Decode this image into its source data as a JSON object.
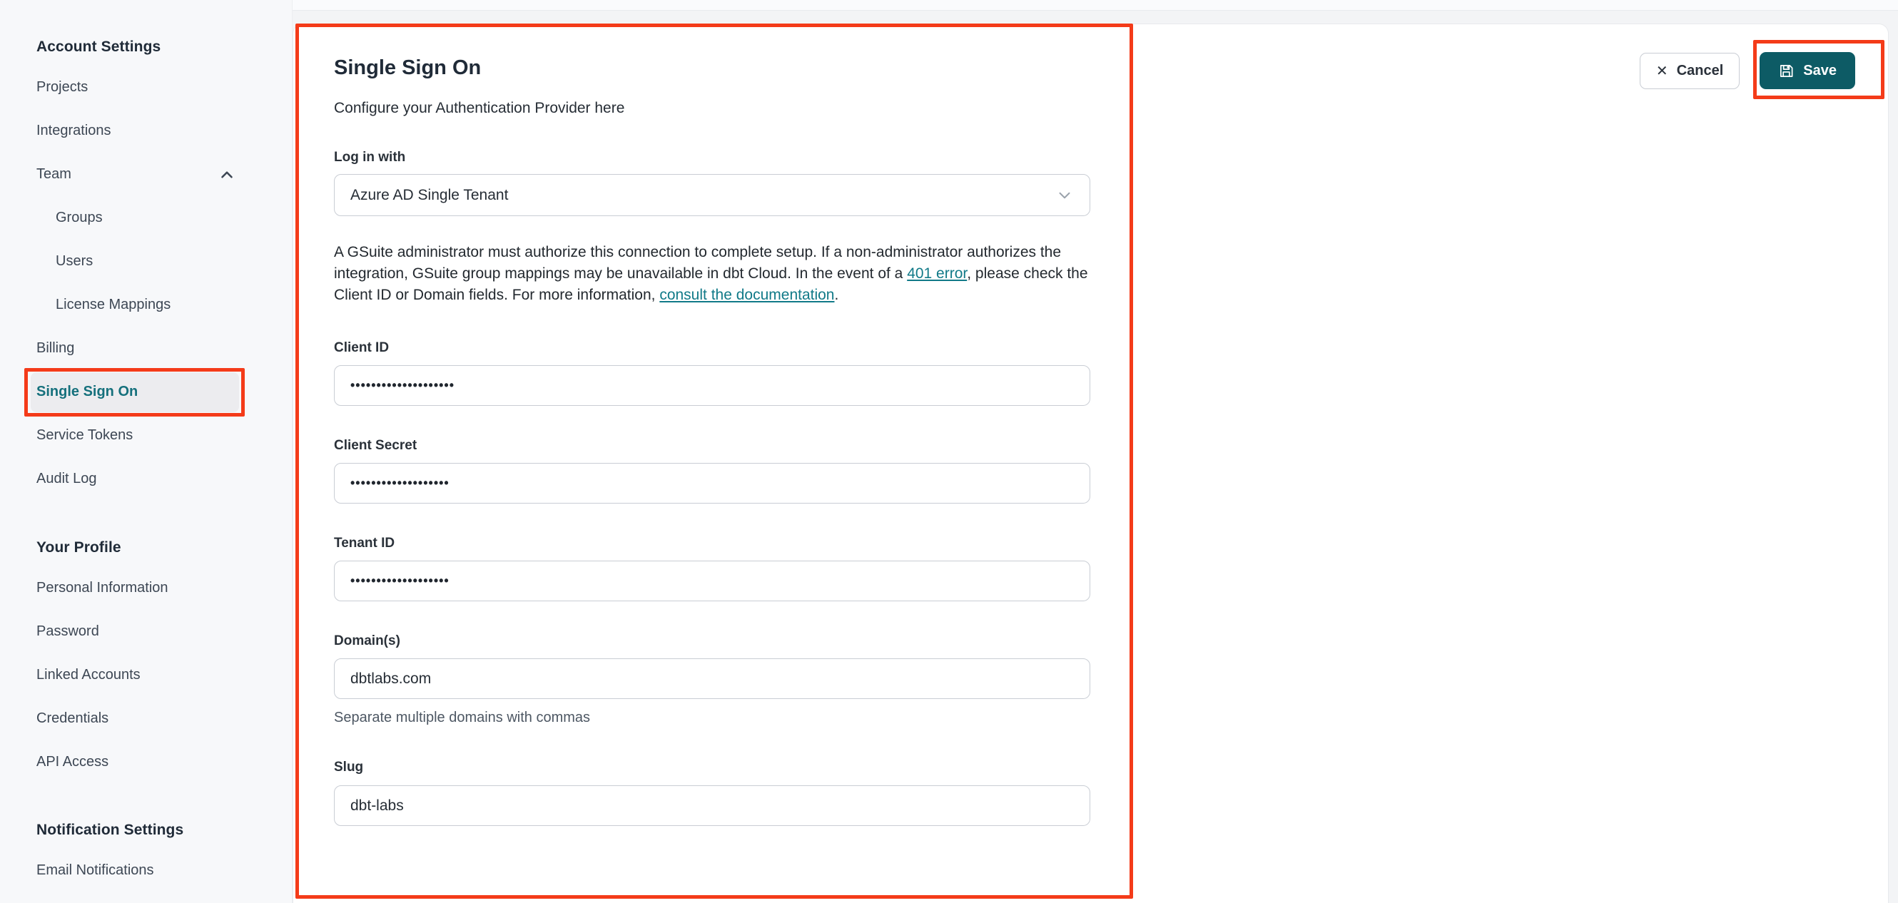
{
  "sidebar": {
    "sections": [
      {
        "heading": "Account Settings",
        "items": [
          {
            "label": "Projects"
          },
          {
            "label": "Integrations"
          },
          {
            "label": "Team",
            "expanded": true
          },
          {
            "label": "Groups",
            "sub": true
          },
          {
            "label": "Users",
            "sub": true
          },
          {
            "label": "License Mappings",
            "sub": true
          },
          {
            "label": "Billing"
          },
          {
            "label": "Single Sign On",
            "active": true
          },
          {
            "label": "Service Tokens"
          },
          {
            "label": "Audit Log"
          }
        ]
      },
      {
        "heading": "Your Profile",
        "items": [
          {
            "label": "Personal Information"
          },
          {
            "label": "Password"
          },
          {
            "label": "Linked Accounts"
          },
          {
            "label": "Credentials"
          },
          {
            "label": "API Access"
          }
        ]
      },
      {
        "heading": "Notification Settings",
        "items": [
          {
            "label": "Email Notifications"
          }
        ]
      }
    ]
  },
  "header_actions": {
    "cancel_label": "Cancel",
    "cancel_icon": "✕",
    "save_label": "Save"
  },
  "main": {
    "title": "Single Sign On",
    "subtitle": "Configure your Authentication Provider here",
    "login_with": {
      "label": "Log in with",
      "value": "Azure AD Single Tenant"
    },
    "info": {
      "segments": [
        {
          "text": "A GSuite administrator must authorize this connection to complete setup. If a non-administrator authorizes the integration, GSuite group mappings may be unavailable in dbt Cloud. In the event of a "
        },
        {
          "text": "401 error",
          "link": true
        },
        {
          "text": ", please check the Client ID or Domain fields. For more information, "
        },
        {
          "text": "consult the documentation",
          "link": true
        },
        {
          "text": "."
        }
      ]
    },
    "fields": [
      {
        "label": "Client ID",
        "value": "••••••••••••••••••••",
        "masked": true
      },
      {
        "label": "Client Secret",
        "value": "•••••••••••••••••••",
        "masked": true
      },
      {
        "label": "Tenant ID",
        "value": "•••••••••••••••••••",
        "masked": true
      },
      {
        "label": "Domain(s)",
        "value": "dbtlabs.com",
        "hint": "Separate multiple domains with commas"
      },
      {
        "label": "Slug",
        "value": "dbt-labs"
      }
    ]
  },
  "annotations": {
    "color": "#f43b19",
    "highlighted": [
      "content-panel",
      "sidebar-item-single-sign-on",
      "save-button"
    ]
  },
  "colors": {
    "save_button": "#0d5b65",
    "link_teal": "#117a88",
    "active_item_teal": "#15707c"
  }
}
